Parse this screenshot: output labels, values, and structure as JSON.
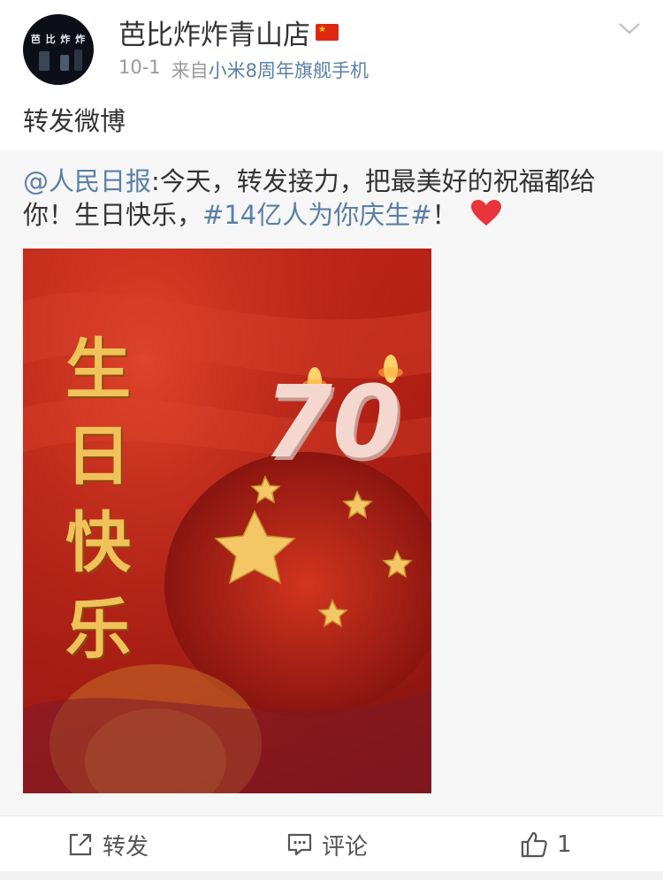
{
  "post": {
    "username": "芭比炸炸青山店",
    "date": "10-1",
    "source_prefix": "来自",
    "source_device": "小米8周年旗舰手机",
    "repost_text": "转发微博",
    "avatar_text": "芭 比 炸 炸"
  },
  "original": {
    "mention": "@人民日报",
    "text_part1": ":今天，转发接力，把最美好的祝福都给你！生日快乐，",
    "hashtag": "#14亿人为你庆生#",
    "text_part2": "！",
    "poster": {
      "title_chars": [
        "生",
        "日",
        "快",
        "乐"
      ],
      "number": "70"
    }
  },
  "actions": {
    "repost_label": "转发",
    "comment_label": "评论",
    "like_count": "1"
  },
  "colors": {
    "link": "#5b7fa6",
    "flag_red": "#de2910",
    "heart": "#e8343a"
  },
  "icons": [
    "flag-icon",
    "chevron-down-icon",
    "heart-icon",
    "repost-icon",
    "comment-icon",
    "like-icon"
  ]
}
